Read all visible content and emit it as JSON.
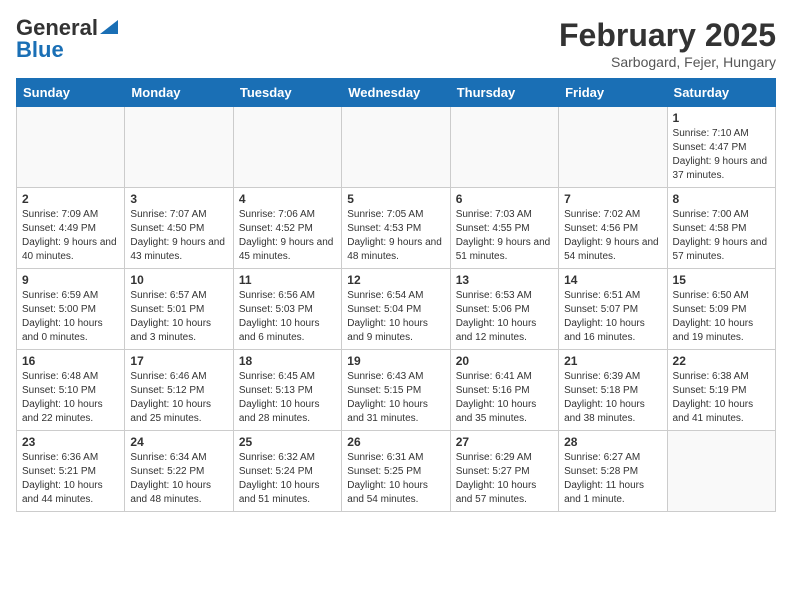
{
  "header": {
    "logo_general": "General",
    "logo_blue": "Blue",
    "month_title": "February 2025",
    "location": "Sarbogard, Fejer, Hungary"
  },
  "days_of_week": [
    "Sunday",
    "Monday",
    "Tuesday",
    "Wednesday",
    "Thursday",
    "Friday",
    "Saturday"
  ],
  "weeks": [
    [
      {
        "day": "",
        "info": ""
      },
      {
        "day": "",
        "info": ""
      },
      {
        "day": "",
        "info": ""
      },
      {
        "day": "",
        "info": ""
      },
      {
        "day": "",
        "info": ""
      },
      {
        "day": "",
        "info": ""
      },
      {
        "day": "1",
        "info": "Sunrise: 7:10 AM\nSunset: 4:47 PM\nDaylight: 9 hours and 37 minutes."
      }
    ],
    [
      {
        "day": "2",
        "info": "Sunrise: 7:09 AM\nSunset: 4:49 PM\nDaylight: 9 hours and 40 minutes."
      },
      {
        "day": "3",
        "info": "Sunrise: 7:07 AM\nSunset: 4:50 PM\nDaylight: 9 hours and 43 minutes."
      },
      {
        "day": "4",
        "info": "Sunrise: 7:06 AM\nSunset: 4:52 PM\nDaylight: 9 hours and 45 minutes."
      },
      {
        "day": "5",
        "info": "Sunrise: 7:05 AM\nSunset: 4:53 PM\nDaylight: 9 hours and 48 minutes."
      },
      {
        "day": "6",
        "info": "Sunrise: 7:03 AM\nSunset: 4:55 PM\nDaylight: 9 hours and 51 minutes."
      },
      {
        "day": "7",
        "info": "Sunrise: 7:02 AM\nSunset: 4:56 PM\nDaylight: 9 hours and 54 minutes."
      },
      {
        "day": "8",
        "info": "Sunrise: 7:00 AM\nSunset: 4:58 PM\nDaylight: 9 hours and 57 minutes."
      }
    ],
    [
      {
        "day": "9",
        "info": "Sunrise: 6:59 AM\nSunset: 5:00 PM\nDaylight: 10 hours and 0 minutes."
      },
      {
        "day": "10",
        "info": "Sunrise: 6:57 AM\nSunset: 5:01 PM\nDaylight: 10 hours and 3 minutes."
      },
      {
        "day": "11",
        "info": "Sunrise: 6:56 AM\nSunset: 5:03 PM\nDaylight: 10 hours and 6 minutes."
      },
      {
        "day": "12",
        "info": "Sunrise: 6:54 AM\nSunset: 5:04 PM\nDaylight: 10 hours and 9 minutes."
      },
      {
        "day": "13",
        "info": "Sunrise: 6:53 AM\nSunset: 5:06 PM\nDaylight: 10 hours and 12 minutes."
      },
      {
        "day": "14",
        "info": "Sunrise: 6:51 AM\nSunset: 5:07 PM\nDaylight: 10 hours and 16 minutes."
      },
      {
        "day": "15",
        "info": "Sunrise: 6:50 AM\nSunset: 5:09 PM\nDaylight: 10 hours and 19 minutes."
      }
    ],
    [
      {
        "day": "16",
        "info": "Sunrise: 6:48 AM\nSunset: 5:10 PM\nDaylight: 10 hours and 22 minutes."
      },
      {
        "day": "17",
        "info": "Sunrise: 6:46 AM\nSunset: 5:12 PM\nDaylight: 10 hours and 25 minutes."
      },
      {
        "day": "18",
        "info": "Sunrise: 6:45 AM\nSunset: 5:13 PM\nDaylight: 10 hours and 28 minutes."
      },
      {
        "day": "19",
        "info": "Sunrise: 6:43 AM\nSunset: 5:15 PM\nDaylight: 10 hours and 31 minutes."
      },
      {
        "day": "20",
        "info": "Sunrise: 6:41 AM\nSunset: 5:16 PM\nDaylight: 10 hours and 35 minutes."
      },
      {
        "day": "21",
        "info": "Sunrise: 6:39 AM\nSunset: 5:18 PM\nDaylight: 10 hours and 38 minutes."
      },
      {
        "day": "22",
        "info": "Sunrise: 6:38 AM\nSunset: 5:19 PM\nDaylight: 10 hours and 41 minutes."
      }
    ],
    [
      {
        "day": "23",
        "info": "Sunrise: 6:36 AM\nSunset: 5:21 PM\nDaylight: 10 hours and 44 minutes."
      },
      {
        "day": "24",
        "info": "Sunrise: 6:34 AM\nSunset: 5:22 PM\nDaylight: 10 hours and 48 minutes."
      },
      {
        "day": "25",
        "info": "Sunrise: 6:32 AM\nSunset: 5:24 PM\nDaylight: 10 hours and 51 minutes."
      },
      {
        "day": "26",
        "info": "Sunrise: 6:31 AM\nSunset: 5:25 PM\nDaylight: 10 hours and 54 minutes."
      },
      {
        "day": "27",
        "info": "Sunrise: 6:29 AM\nSunset: 5:27 PM\nDaylight: 10 hours and 57 minutes."
      },
      {
        "day": "28",
        "info": "Sunrise: 6:27 AM\nSunset: 5:28 PM\nDaylight: 11 hours and 1 minute."
      },
      {
        "day": "",
        "info": ""
      }
    ]
  ]
}
